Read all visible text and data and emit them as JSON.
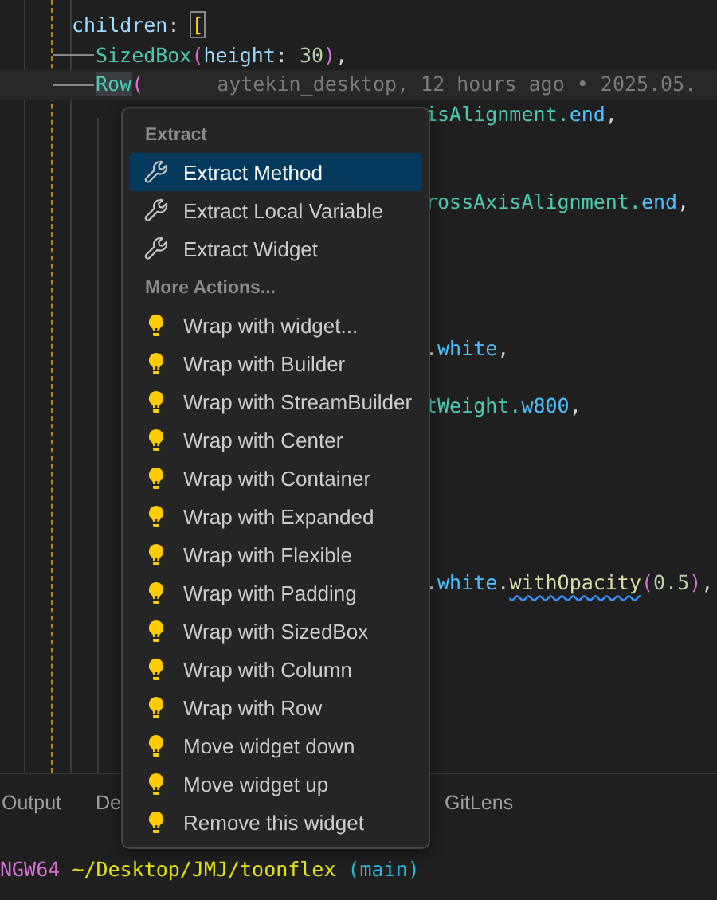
{
  "editor": {
    "lines": [
      {
        "kind": "blank"
      },
      {
        "kind": "field",
        "tokens": [
          {
            "text": "children",
            "kind": "prop"
          },
          {
            "text": ": ",
            "kind": "plain"
          },
          {
            "text": "[",
            "kind": "bracket-match"
          }
        ]
      },
      {
        "kind": "child",
        "tokens": [
          {
            "text": "SizedBox",
            "kind": "class"
          },
          {
            "text": "(",
            "kind": "paren"
          },
          {
            "text": "height",
            "kind": "prop"
          },
          {
            "text": ": ",
            "kind": "plain"
          },
          {
            "text": "30",
            "kind": "number"
          },
          {
            "text": ")",
            "kind": "paren"
          },
          {
            "text": ",",
            "kind": "plain"
          }
        ]
      },
      {
        "kind": "child",
        "current": true,
        "tokens": [
          {
            "text": "Row",
            "kind": "class-hl"
          },
          {
            "text": "(",
            "kind": "paren"
          }
        ],
        "blame": "aytekin_desktop, 12 hours ago • 2025.05."
      },
      {
        "kind": "covered",
        "tokens": [
          {
            "text": "isAlignment.",
            "kind": "class"
          },
          {
            "text": "end",
            "kind": "member"
          },
          {
            "text": ",",
            "kind": "plain"
          }
        ]
      },
      {
        "kind": "blank"
      },
      {
        "kind": "blank"
      },
      {
        "kind": "covered",
        "tokens": [
          {
            "text": "rossAxisAlignment.",
            "kind": "class"
          },
          {
            "text": "end",
            "kind": "member"
          },
          {
            "text": ",",
            "kind": "plain"
          }
        ]
      },
      {
        "kind": "blank"
      },
      {
        "kind": "blank"
      },
      {
        "kind": "blank"
      },
      {
        "kind": "blank"
      },
      {
        "kind": "covered",
        "tokens": [
          {
            "text": ".",
            "kind": "plain"
          },
          {
            "text": "white",
            "kind": "member"
          },
          {
            "text": ",",
            "kind": "plain"
          }
        ]
      },
      {
        "kind": "blank"
      },
      {
        "kind": "covered",
        "tokens": [
          {
            "text": "tWeight.",
            "kind": "class"
          },
          {
            "text": "w800",
            "kind": "member"
          },
          {
            "text": ",",
            "kind": "plain"
          }
        ]
      },
      {
        "kind": "blank"
      },
      {
        "kind": "blank"
      },
      {
        "kind": "blank"
      },
      {
        "kind": "blank"
      },
      {
        "kind": "blank"
      },
      {
        "kind": "covered",
        "tokens": [
          {
            "text": ".",
            "kind": "plain"
          },
          {
            "text": "white",
            "kind": "member"
          },
          {
            "text": ".",
            "kind": "plain"
          },
          {
            "text": "withOpacity",
            "kind": "deprecated"
          },
          {
            "text": "(",
            "kind": "paren"
          },
          {
            "text": "0.5",
            "kind": "number"
          },
          {
            "text": ")",
            "kind": "paren"
          },
          {
            "text": ",",
            "kind": "plain"
          }
        ]
      }
    ]
  },
  "panel": {
    "tabs": [
      {
        "label": "Output"
      },
      {
        "label": "De"
      },
      {
        "label": "GitLens"
      }
    ],
    "terminal": [
      {
        "text": "NGW64",
        "kind": "host"
      },
      {
        "text": " ~/Desktop/JMJ/toonflex",
        "kind": "path"
      },
      {
        "text": " (main)",
        "kind": "branch"
      }
    ]
  },
  "menu": {
    "sections": [
      {
        "header": "Extract",
        "items": [
          {
            "label": "Extract Method",
            "kind": "wrench",
            "selected": true
          },
          {
            "label": "Extract Local Variable",
            "kind": "wrench",
            "selected": false
          },
          {
            "label": "Extract Widget",
            "kind": "wrench",
            "selected": false
          }
        ]
      },
      {
        "header": "More Actions...",
        "items": [
          {
            "label": "Wrap with widget...",
            "kind": "bulb",
            "selected": false
          },
          {
            "label": "Wrap with Builder",
            "kind": "bulb",
            "selected": false
          },
          {
            "label": "Wrap with StreamBuilder",
            "kind": "bulb",
            "selected": false
          },
          {
            "label": "Wrap with Center",
            "kind": "bulb",
            "selected": false
          },
          {
            "label": "Wrap with Container",
            "kind": "bulb",
            "selected": false
          },
          {
            "label": "Wrap with Expanded",
            "kind": "bulb",
            "selected": false
          },
          {
            "label": "Wrap with Flexible",
            "kind": "bulb",
            "selected": false
          },
          {
            "label": "Wrap with Padding",
            "kind": "bulb",
            "selected": false
          },
          {
            "label": "Wrap with SizedBox",
            "kind": "bulb",
            "selected": false
          },
          {
            "label": "Wrap with Column",
            "kind": "bulb",
            "selected": false
          },
          {
            "label": "Wrap with Row",
            "kind": "bulb",
            "selected": false
          },
          {
            "label": "Move widget down",
            "kind": "bulb",
            "selected": false
          },
          {
            "label": "Move widget up",
            "kind": "bulb",
            "selected": false
          },
          {
            "label": "Remove this widget",
            "kind": "bulb",
            "selected": false
          }
        ]
      }
    ]
  }
}
